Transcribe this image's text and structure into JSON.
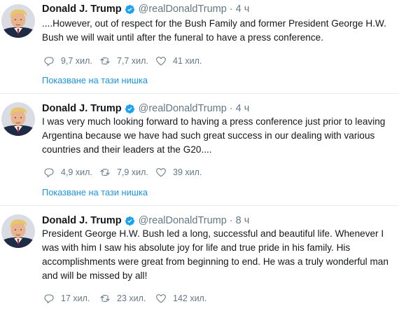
{
  "tweets": [
    {
      "name": "Donald J. Trump",
      "handle": "@realDonaldTrump",
      "separator": "·",
      "time": "4 ч",
      "lines": [
        "....However, out of respect for the Bush Family and former President George H.W.",
        "Bush we will wait until after the funeral to have a press conference."
      ],
      "replies": "9,7 хил.",
      "retweets": "7,7 хил.",
      "likes": "41 хил.",
      "thread_link": "Показване на тази нишка"
    },
    {
      "name": "Donald J. Trump",
      "handle": "@realDonaldTrump",
      "separator": "·",
      "time": "4 ч",
      "lines": [
        "I was very much looking forward to having a press conference just prior to leaving",
        "Argentina because we have had such great success in our dealing with various",
        "countries and their leaders at the G20...."
      ],
      "replies": "4,9 хил.",
      "retweets": "7,9 хил.",
      "likes": "39 хил.",
      "thread_link": "Показване на тази нишка"
    },
    {
      "name": "Donald J. Trump",
      "handle": "@realDonaldTrump",
      "separator": "·",
      "time": "8 ч",
      "lines": [
        "President George H.W. Bush led a long, successful and beautiful life.  Whenever I",
        "was with him I saw his absolute joy for life and true pride in his family. His",
        "accomplishments were great from beginning to end. He was a truly wonderful man",
        "and will be missed by all!"
      ],
      "replies": "17 хил.",
      "retweets": "23 хил.",
      "likes": "142 хил."
    }
  ],
  "colors": {
    "link": "#1b95e0",
    "secondary_text": "#657786",
    "verified_badge": "#1da1f2",
    "divider": "#e6ecf0"
  },
  "icons": {
    "verified": "verified-badge-icon",
    "reply": "reply-icon",
    "retweet": "retweet-icon",
    "like": "heart-icon"
  }
}
